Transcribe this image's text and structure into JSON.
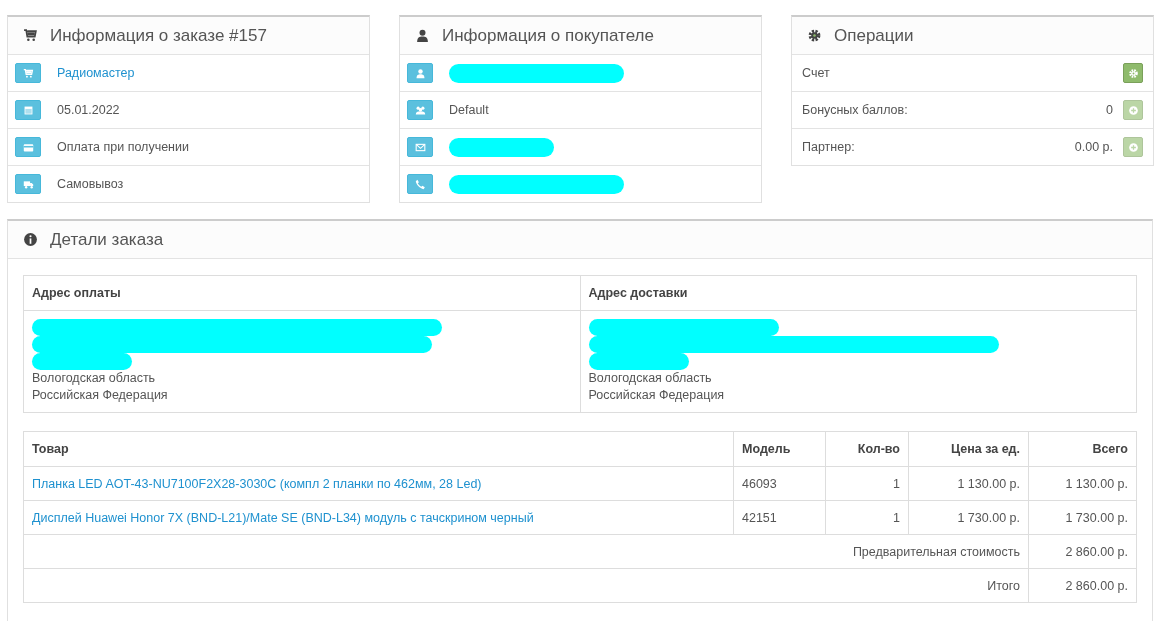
{
  "order_panel": {
    "title": "Информация о заказе #157",
    "rows": [
      {
        "text": "Радиомастер",
        "link": true
      },
      {
        "text": "05.01.2022",
        "link": false
      },
      {
        "text": "Оплата при получении",
        "link": false
      },
      {
        "text": "Самовывоз",
        "link": false
      }
    ]
  },
  "customer_panel": {
    "title": "Информация о покупателе",
    "rows": [
      {
        "kind": "redacted"
      },
      {
        "kind": "text",
        "text": "Default"
      },
      {
        "kind": "redacted"
      },
      {
        "kind": "redacted"
      }
    ]
  },
  "operations_panel": {
    "title": "Операции",
    "rows": [
      {
        "label": "Счет",
        "disabled": false
      },
      {
        "label": "Бонусных баллов:",
        "value": "0",
        "disabled": true
      },
      {
        "label": "Партнер:",
        "value": "0.00 р.",
        "disabled": true
      }
    ]
  },
  "details_panel": {
    "title": "Детали заказа",
    "addresses": [
      {
        "heading": "Адрес оплаты",
        "lines": [
          "Вологодская область",
          "Российская Федерация"
        ]
      },
      {
        "heading": "Адрес доставки",
        "lines": [
          "Вологодская область",
          "Российская Федерация"
        ]
      }
    ],
    "table": {
      "columns": [
        "Товар",
        "Модель",
        "Кол-во",
        "Цена за ед.",
        "Всего"
      ],
      "rows": [
        {
          "product": "Планка LED AOT-43-NU7100F2X28-3030C (компл 2 планки по 462мм, 28 Led)",
          "model": "46093",
          "qty": "1",
          "price": "1 130.00 р.",
          "total": "1 130.00 р."
        },
        {
          "product": "Дисплей Huawei Honor 7X (BND-L21)/Mate SE (BND-L34) модуль с тачскрином черный",
          "model": "42151",
          "qty": "1",
          "price": "1 730.00 р.",
          "total": "1 730.00 р."
        }
      ],
      "totals": [
        {
          "label": "Предварительная стоимость",
          "value": "2 860.00 р."
        },
        {
          "label": "Итого",
          "value": "2 860.00 р."
        }
      ]
    }
  }
}
